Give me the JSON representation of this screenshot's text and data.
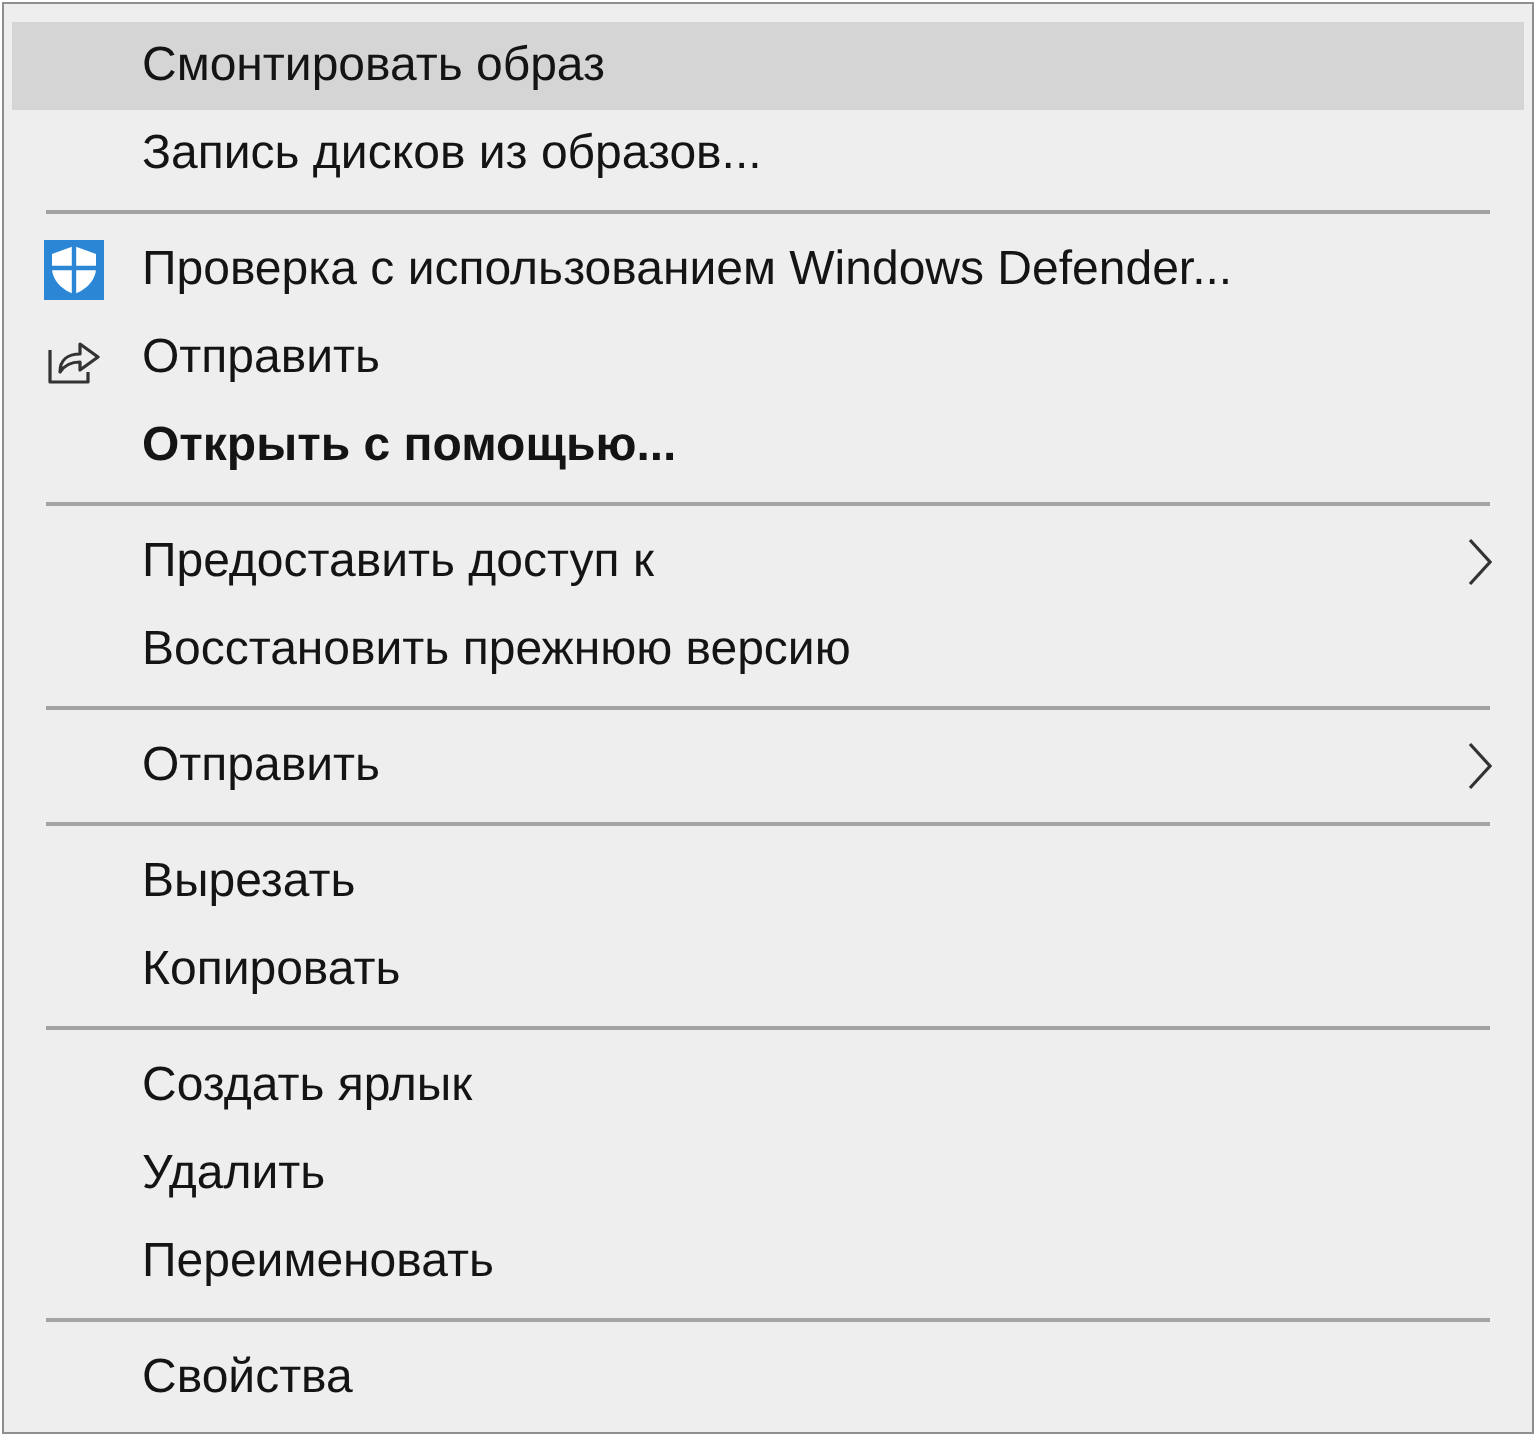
{
  "context_menu": {
    "groups": [
      {
        "items": [
          {
            "label": "Смонтировать образ",
            "kind": "plain",
            "selected": true
          },
          {
            "label": "Запись дисков из образов...",
            "kind": "plain",
            "selected": false
          }
        ]
      },
      {
        "items": [
          {
            "label": "Проверка с использованием Windows Defender...",
            "kind": "scan",
            "selected": false
          },
          {
            "label": "Отправить",
            "kind": "share",
            "selected": false
          },
          {
            "label": "Открыть с помощью...",
            "kind": "default",
            "selected": false
          }
        ]
      },
      {
        "items": [
          {
            "label": "Предоставить доступ к",
            "kind": "submenu",
            "selected": false
          },
          {
            "label": "Восстановить прежнюю версию",
            "kind": "plain",
            "selected": false
          }
        ]
      },
      {
        "items": [
          {
            "label": "Отправить",
            "kind": "submenu",
            "selected": false
          }
        ]
      },
      {
        "items": [
          {
            "label": "Вырезать",
            "kind": "plain",
            "selected": false
          },
          {
            "label": "Копировать",
            "kind": "plain",
            "selected": false
          }
        ]
      },
      {
        "items": [
          {
            "label": "Создать ярлык",
            "kind": "plain",
            "selected": false
          },
          {
            "label": "Удалить",
            "kind": "plain",
            "selected": false
          },
          {
            "label": "Переименовать",
            "kind": "plain",
            "selected": false
          }
        ]
      },
      {
        "items": [
          {
            "label": "Свойства",
            "kind": "plain",
            "selected": false
          }
        ]
      }
    ]
  }
}
